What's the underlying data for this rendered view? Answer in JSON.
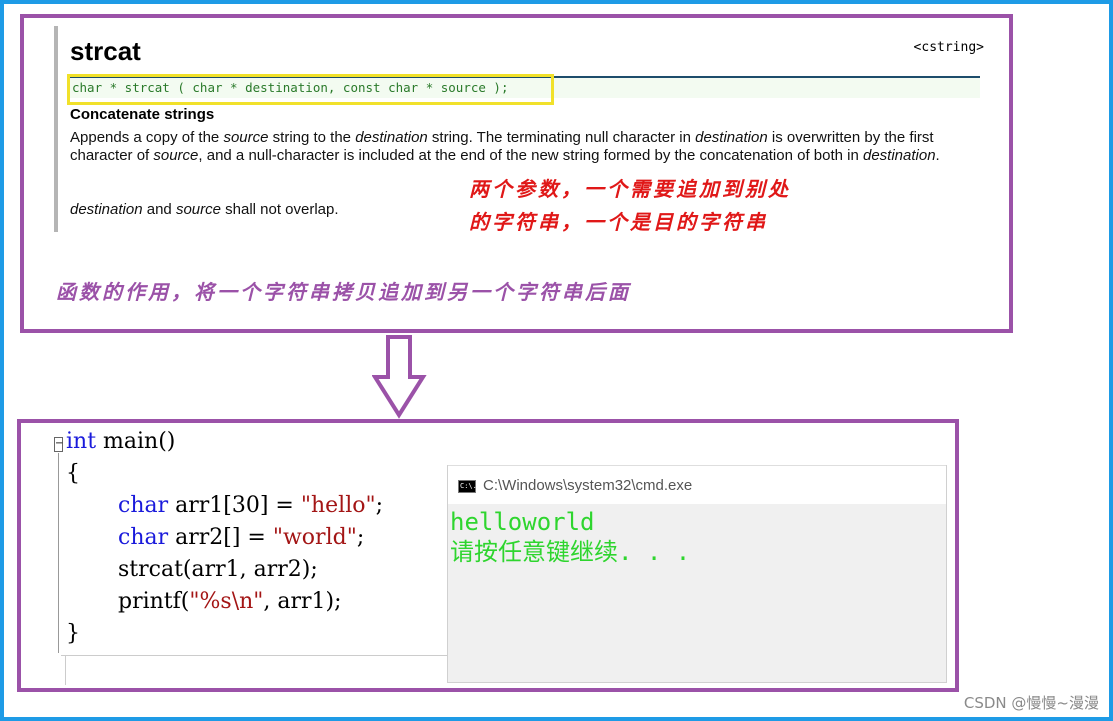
{
  "reference": {
    "function_name": "strcat",
    "header": "<cstring>",
    "prototype": "char * strcat ( char * destination, const char * source );",
    "subtitle": "Concatenate strings",
    "desc_parts": [
      "Appends a copy of the ",
      "source",
      " string to the ",
      "destination",
      " string. The terminating null character in ",
      "destination",
      " is overwritten by the first character of ",
      "source",
      ", and a null-character is included at the end of the new string formed by the concatenation of both in ",
      "destination",
      "."
    ],
    "desc2_parts": [
      "destination",
      " and ",
      "source",
      " shall not overlap."
    ]
  },
  "annotations": {
    "params_line1": "两个参数，一个需要追加到别处",
    "params_line2": "的字符串，一个是目的字符串",
    "purpose": "函数的作用，将一个字符串拷贝追加到另一个字符串后面"
  },
  "code": {
    "fold_symbol": "−",
    "line1_kw": "int",
    "line1_rest": " main()",
    "line2": "{",
    "line3_kw": "char",
    "line3_mid": " arr1[30] = ",
    "line3_str": "\"hello\"",
    "line3_end": ";",
    "line4_kw": "char",
    "line4_mid": " arr2[] = ",
    "line4_str": "\"world\"",
    "line4_end": ";",
    "line5": "strcat(arr1, arr2);",
    "line6_a": "printf(",
    "line6_str": "\"%s\\n\"",
    "line6_b": ", arr1);",
    "line7": "}"
  },
  "console": {
    "icon_text": "C:\\.",
    "title": "C:\\Windows\\system32\\cmd.exe",
    "output_line1": "helloworld",
    "output_line2": "请按任意键继续. . ."
  },
  "watermark": "CSDN @慢慢~漫漫",
  "colors": {
    "frame": "#1e9be6",
    "panel_border": "#9b52a8",
    "highlight": "#f1e12a",
    "red_note": "#e01818",
    "console_text": "#2ed52e"
  }
}
